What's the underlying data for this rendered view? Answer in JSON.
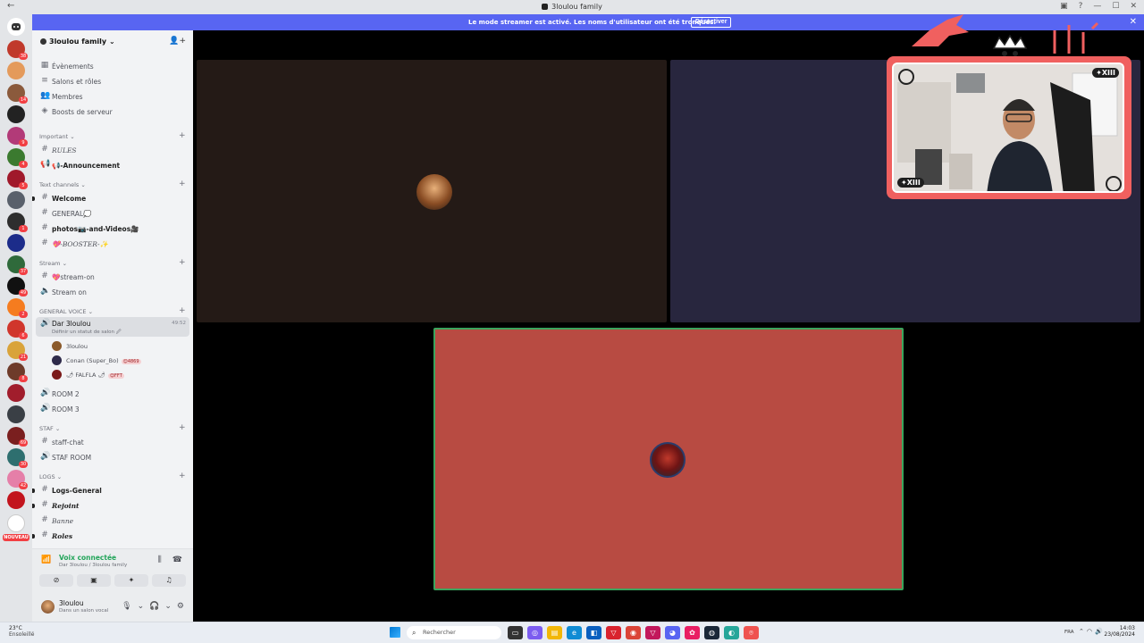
{
  "window": {
    "title": "3loulou family"
  },
  "banner": {
    "text": "Le mode streamer est activé. Les noms d'utilisateur ont été tronqués.",
    "button": "Désactiver",
    "close": "✕",
    "color": "#5865f2"
  },
  "server": {
    "name": "3loulou family",
    "chevron": "⌄",
    "menu": [
      {
        "label": "Évènements",
        "icon": "calendar-icon"
      },
      {
        "label": "Salons et rôles",
        "icon": "list-icon"
      },
      {
        "label": "Membres",
        "icon": "members-icon"
      },
      {
        "label": "Boosts de serveur",
        "icon": "boost-icon"
      }
    ],
    "categories": {
      "important": "Important",
      "text": "Text channels",
      "stream": "Stream",
      "voice": "GENERAL VOICE",
      "staf": "STAF",
      "logs": "LOGS"
    },
    "channels": {
      "rules": "𝑅𝑈𝐿𝐸𝑆",
      "announcement": "📢-Announcement",
      "welcome": "Welcome",
      "general": "GENERAL💭",
      "photos": "photos📷-and-Videos🎥",
      "booster": "💖-𝐵𝑂𝑂𝑆𝑇𝐸𝑅-✨",
      "stream_on_text": "💖stream-on",
      "stream_on_voice": "Stream on",
      "dar": "Dar 3loulou",
      "dar_sub": "Définir un statut de salon 🖉",
      "dar_time": "49:52",
      "room2": "ROOM 2",
      "room3": "ROOM 3",
      "staff_chat": "staff-chat",
      "staf_room": "STAF ROOM",
      "logs_general": "Logs-General",
      "rejoint": "Rejoint",
      "banne": "Banne",
      "roles": "Roles"
    },
    "voice_users": [
      {
        "name": "3loulou",
        "tag": ""
      },
      {
        "name": "Conan (Super_Bo)",
        "tag": "😊4869"
      },
      {
        "name": "🌶 FALFLA 🌶",
        "tag": "😊FFT"
      }
    ]
  },
  "voice_panel": {
    "status": "Voix connectée",
    "location": "Dar 3loulou / 3loulou family",
    "icons": [
      "noise-suppression-icon",
      "disconnect-icon"
    ],
    "buttons": [
      "camera-off-icon",
      "screen-share-icon",
      "activity-icon",
      "soundboard-icon"
    ]
  },
  "user_panel": {
    "name": "3loulou",
    "status": "Dans un salon vocal"
  },
  "camera_overlay": {
    "tag_top": "✦XIII",
    "tag_bottom": "✦XIII",
    "accent": "#f0605f"
  },
  "taskbar": {
    "weather_temp": "23°C",
    "weather_desc": "Ensoleillé",
    "search": "Rechercher",
    "lang": "FRA",
    "time": "14:03",
    "date": "23/08/2024"
  },
  "server_badges": [
    "38",
    "14",
    "9",
    "4",
    "5",
    "1",
    "37",
    "49",
    "2",
    "6",
    "21",
    "8",
    "69",
    "30",
    "42"
  ],
  "server_new_label": "NOUVEAU",
  "colors": {
    "tile1": "#241a16",
    "tile2": "#28263e",
    "tile3": "#b84b42",
    "speaking": "#3ba55d",
    "connected": "#23a55a"
  }
}
